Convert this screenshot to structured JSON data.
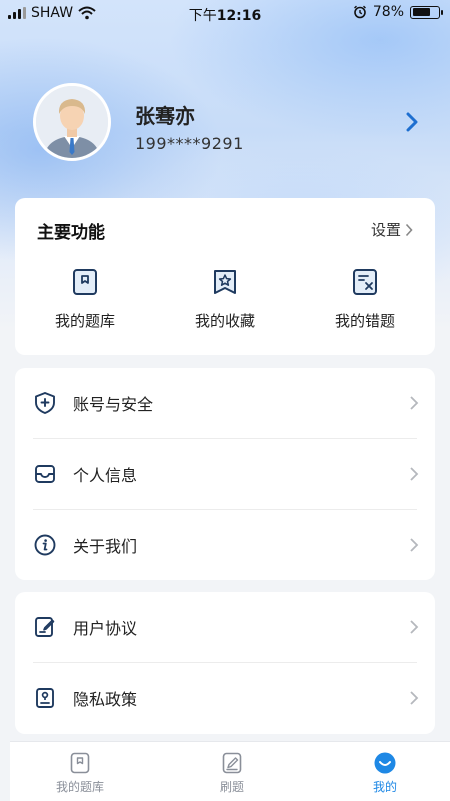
{
  "status_bar": {
    "carrier": "SHAW",
    "time_prefix": "下午",
    "time": "12:16",
    "battery": "78%",
    "battery_level": 0.78
  },
  "profile": {
    "name": "张骞亦",
    "phone": "199****9291",
    "avatar_icon": "user-avatar"
  },
  "main_functions": {
    "title": "主要功能",
    "settings_label": "设置",
    "items": [
      {
        "label": "我的题库",
        "icon": "question-bank-icon"
      },
      {
        "label": "我的收藏",
        "icon": "favorites-icon"
      },
      {
        "label": "我的错题",
        "icon": "wrong-questions-icon"
      }
    ]
  },
  "menu_group_1": [
    {
      "label": "账号与安全",
      "icon": "shield-plus-icon"
    },
    {
      "label": "个人信息",
      "icon": "inbox-icon"
    },
    {
      "label": "关于我们",
      "icon": "info-icon"
    }
  ],
  "menu_group_2": [
    {
      "label": "用户协议",
      "icon": "edit-document-icon"
    },
    {
      "label": "隐私政策",
      "icon": "privacy-document-icon"
    }
  ],
  "tabbar": {
    "items": [
      {
        "label": "我的题库",
        "icon": "question-bank-icon",
        "active": false
      },
      {
        "label": "刷题",
        "icon": "edit-icon",
        "active": false
      },
      {
        "label": "我的",
        "icon": "profile-smile-icon",
        "active": true
      }
    ]
  },
  "colors": {
    "accent": "#1e88e5",
    "icon_dark": "#1f3a5f"
  }
}
